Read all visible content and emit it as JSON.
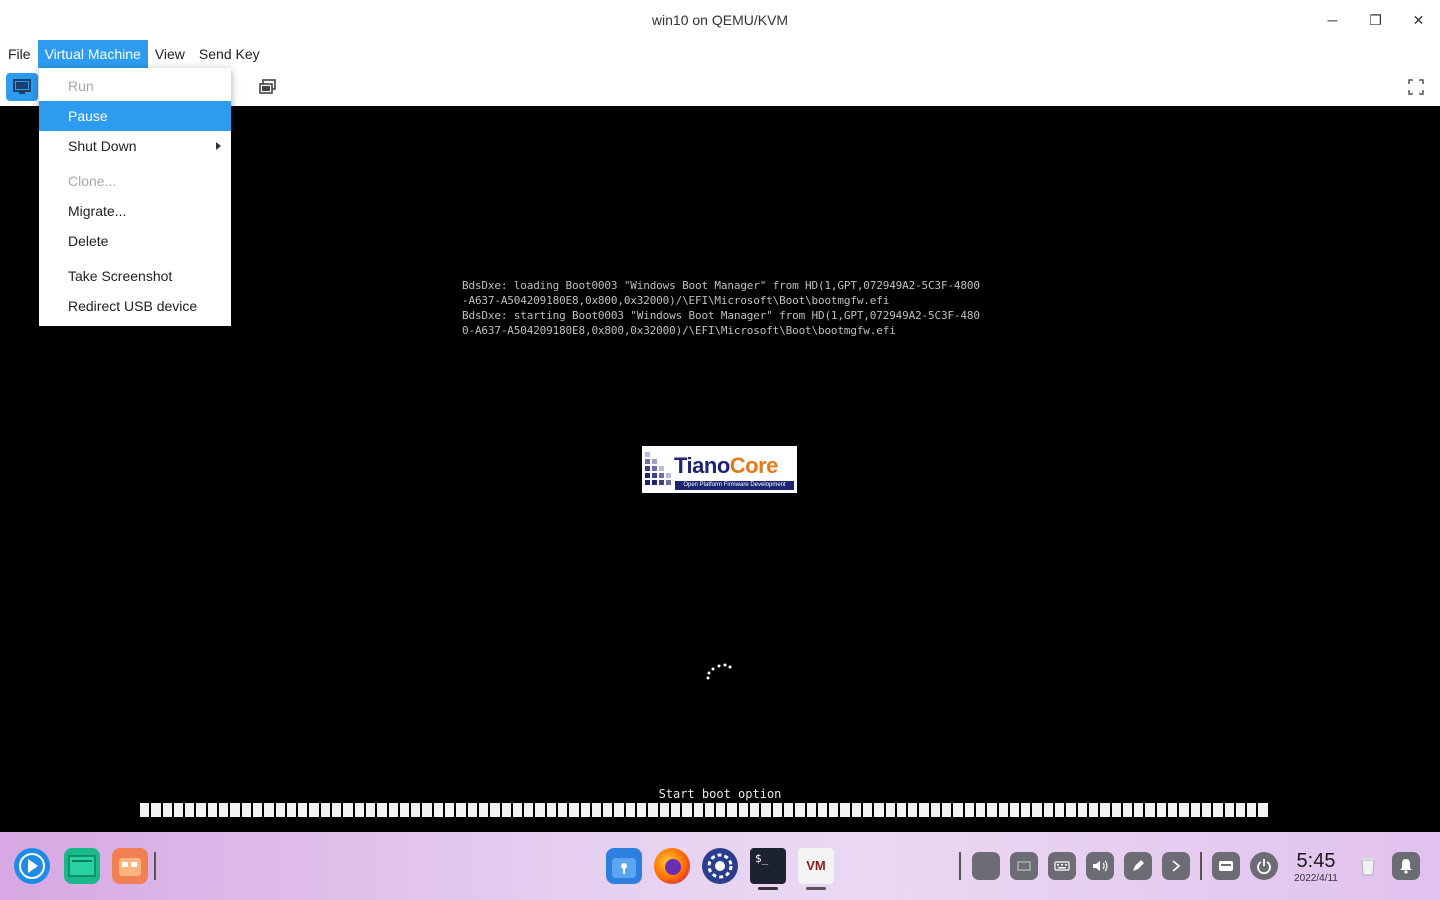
{
  "window": {
    "title": "win10 on QEMU/KVM",
    "minimize": "─",
    "restore": "❐",
    "close": "✕"
  },
  "menubar": {
    "items": [
      "File",
      "Virtual Machine",
      "View",
      "Send Key"
    ],
    "active": "Virtual Machine"
  },
  "toolbar": {
    "icons": [
      "monitor-console-icon",
      "screenshot-icon",
      "fullscreen-icon"
    ]
  },
  "vm_menu": {
    "items": [
      {
        "label": "Run",
        "state": "disabled"
      },
      {
        "label": "Pause",
        "state": "highlighted"
      },
      {
        "label": "Shut Down",
        "state": "submenu"
      },
      {
        "label": "Clone...",
        "state": "disabled"
      },
      {
        "label": "Migrate...",
        "state": "enabled"
      },
      {
        "label": "Delete",
        "state": "enabled"
      },
      {
        "label": "Take Screenshot",
        "state": "enabled"
      },
      {
        "label": "Redirect USB device",
        "state": "enabled"
      }
    ]
  },
  "screen": {
    "boot_log": [
      "BdsDxe: loading Boot0003 \"Windows Boot Manager\" from HD(1,GPT,072949A2-5C3F-4800",
      "-A637-A504209180E8,0x800,0x32000)/\\EFI\\Microsoft\\Boot\\bootmgfw.efi",
      "BdsDxe: starting Boot0003 \"Windows Boot Manager\" from HD(1,GPT,072949A2-5C3F-480",
      "0-A637-A504209180E8,0x800,0x32000)/\\EFI\\Microsoft\\Boot\\bootmgfw.efi"
    ],
    "logo": {
      "name_part1": "Tiano",
      "name_part2": "Core",
      "tagline": "Open Platform Firmware Development"
    },
    "boot_status": "Start boot option",
    "progress_fraction": 1.0
  },
  "taskbar": {
    "apps": [
      "launcher-icon",
      "file-manager-icon",
      "app-store-icon",
      "package-icon",
      "firefox-icon",
      "settings-icon",
      "terminal-icon",
      "virt-manager-icon"
    ],
    "tray": [
      "tray-app-icon",
      "tray-window-icon",
      "keyboard-icon",
      "volume-icon",
      "pen-icon",
      "expand-arrow-icon",
      "onboard-keyboard-icon",
      "power-icon",
      "trash-icon",
      "notification-icon"
    ],
    "terminal_glyph": "$_",
    "vm_glyph": "VM",
    "clock_time": "5:45",
    "clock_date": "2022/4/11"
  },
  "colors": {
    "accent": "#2d9cf0",
    "menu_bg": "#ffffff",
    "screen_bg": "#000000"
  }
}
